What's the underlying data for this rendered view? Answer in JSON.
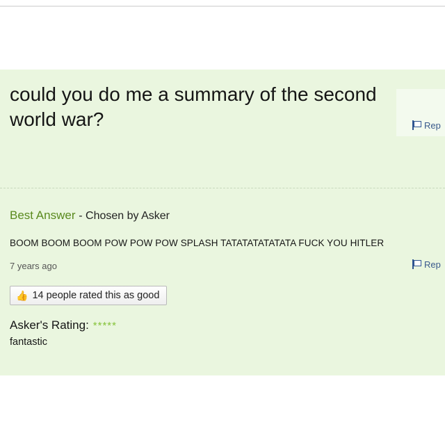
{
  "question": {
    "title": "could you do me a summary of the second world war?",
    "report_label": "Rep"
  },
  "best_answer": {
    "label": "Best Answer",
    "chosen_by": "- Chosen by Asker",
    "text": "BOOM BOOM BOOM POW POW POW SPLASH TATATATATATATA  FUCK YOU HITLER",
    "time": "7 years ago",
    "report_label": "Rep",
    "rated_good": "14 people rated this as good"
  },
  "askers_rating": {
    "label": "Asker's Rating:",
    "stars": 5,
    "stars_text": "*****",
    "comment": "fantastic"
  },
  "colors": {
    "panel_background": "#eaf6df",
    "best_answer_green": "#5a8a1e",
    "star_green": "#86c33b",
    "link_blue": "#3a5a8c"
  },
  "icons": {
    "report": "flag-icon",
    "rating": "thumbs-up-icon"
  }
}
